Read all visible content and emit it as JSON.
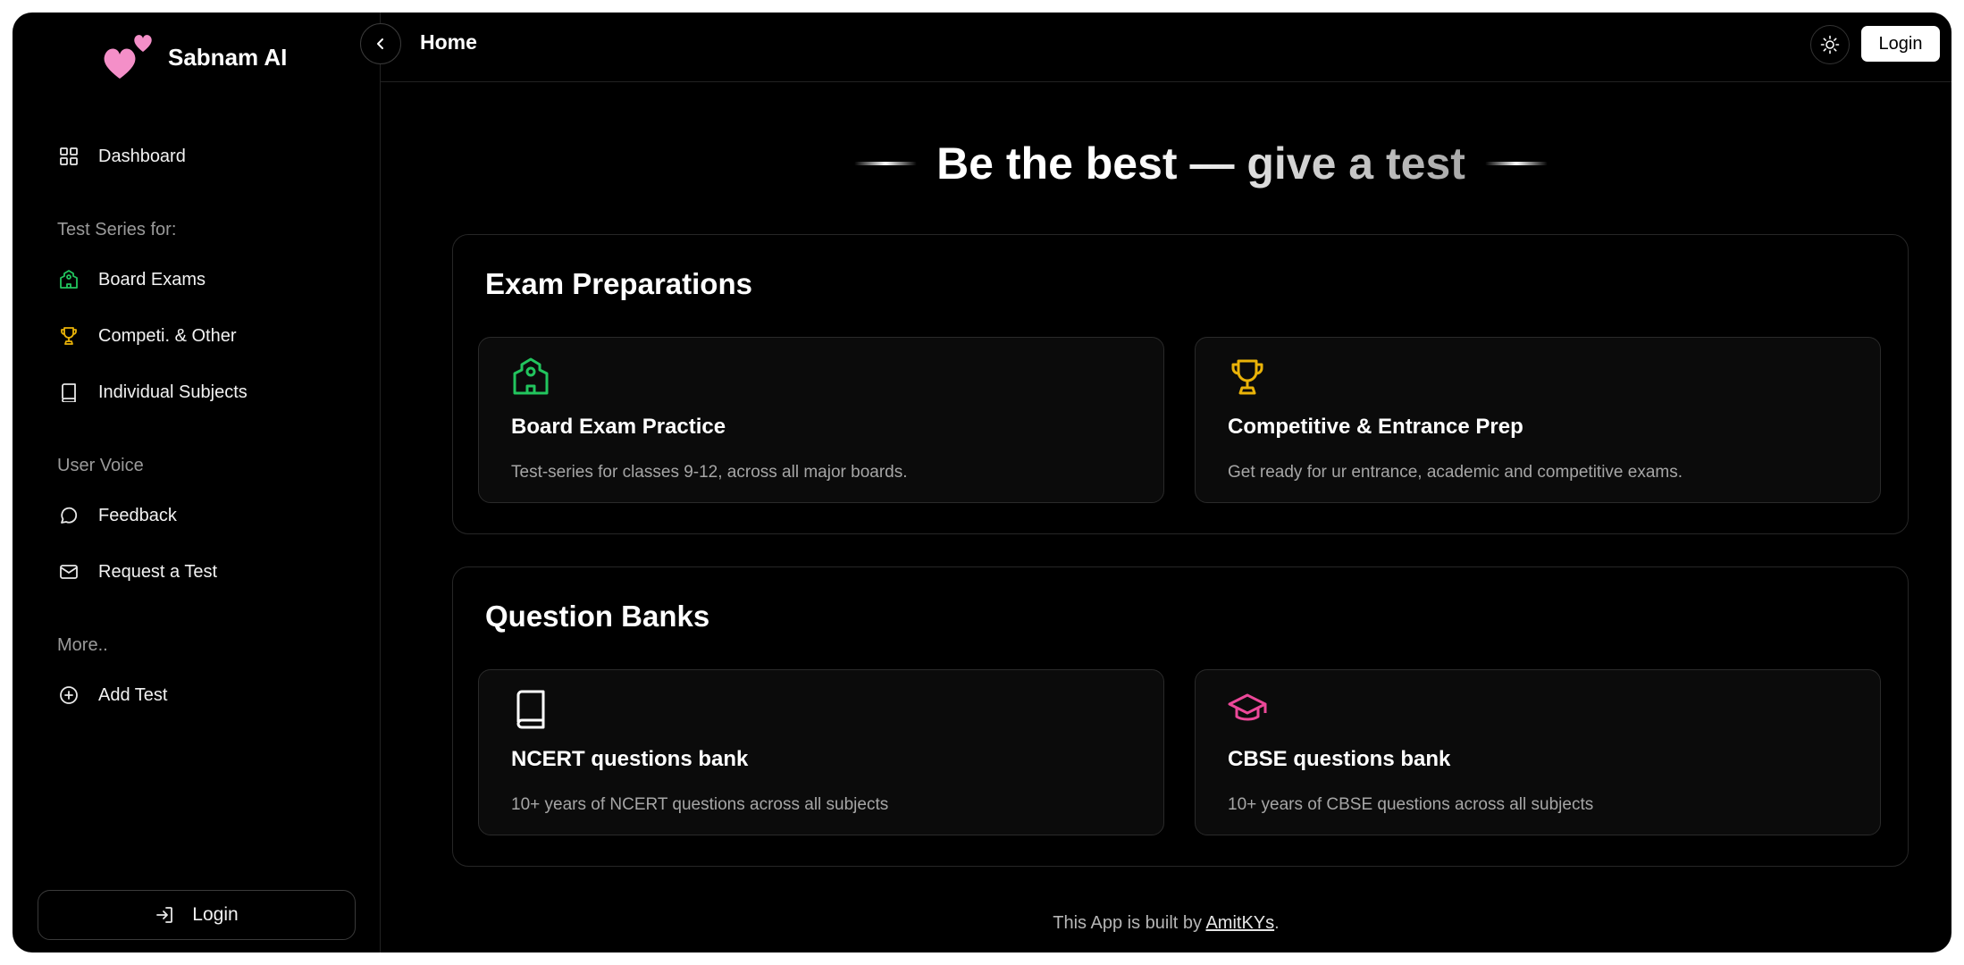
{
  "brand": {
    "name": "Sabnam AI",
    "logo_icon": "hearts-icon",
    "heart_color": "#f48fc8"
  },
  "sidebar": {
    "dashboard": {
      "label": "Dashboard",
      "icon": "grid-icon"
    },
    "section_test_series": "Test Series for:",
    "board_exams": {
      "label": "Board Exams",
      "icon": "school-icon",
      "color": "#22c55e"
    },
    "competitive": {
      "label": "Competi. & Other",
      "icon": "trophy-icon",
      "color": "#eab308"
    },
    "individual_subjects": {
      "label": "Individual Subjects",
      "icon": "book-icon"
    },
    "section_user_voice": "User Voice",
    "feedback": {
      "label": "Feedback",
      "icon": "chat-bubble-icon"
    },
    "request_test": {
      "label": "Request a Test",
      "icon": "mail-icon"
    },
    "section_more": "More..",
    "add_test": {
      "label": "Add Test",
      "icon": "plus-circle-icon"
    },
    "login_label": "Login"
  },
  "topbar": {
    "title": "Home",
    "login_label": "Login",
    "theme_icon": "sun-icon"
  },
  "hero": {
    "text": "Be the best — give a test"
  },
  "exam_preparations": {
    "title": "Exam Preparations",
    "cards": [
      {
        "title": "Board Exam Practice",
        "desc": "Test-series for classes 9-12, across all major boards.",
        "icon": "school-icon",
        "color": "#22c55e"
      },
      {
        "title": "Competitive & Entrance Prep",
        "desc": "Get ready for ur entrance, academic and competitive exams.",
        "icon": "trophy-icon",
        "color": "#eab308"
      }
    ]
  },
  "question_banks": {
    "title": "Question Banks",
    "cards": [
      {
        "title": "NCERT questions bank",
        "desc": "10+ years of NCERT questions across all subjects",
        "icon": "book-icon",
        "color": "#ffffff"
      },
      {
        "title": "CBSE questions bank",
        "desc": "10+ years of CBSE questions across all subjects",
        "icon": "graduation-cap-icon",
        "color": "#ec4899"
      }
    ]
  },
  "footer": {
    "prefix": "This App is built by ",
    "author": "AmitKYs",
    "suffix": "."
  }
}
